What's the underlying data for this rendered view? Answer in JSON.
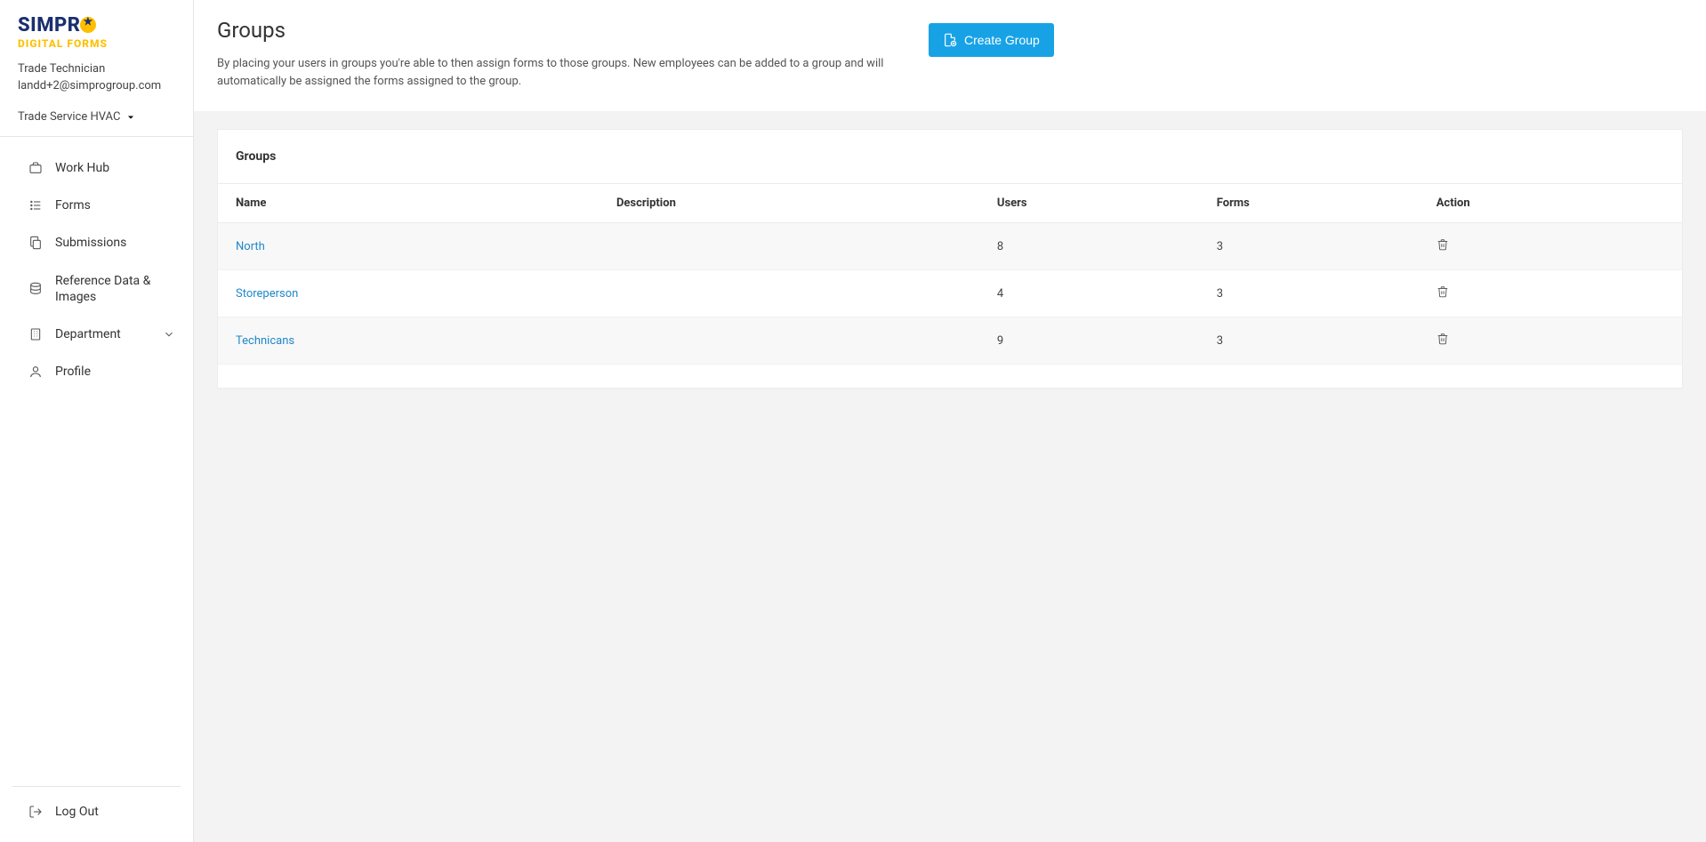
{
  "brand": {
    "line1": "SIMPR",
    "line2": "DIGITAL FORMS"
  },
  "user": {
    "role": "Trade Technician",
    "email": "landd+2@simprogroup.com",
    "org": "Trade Service HVAC"
  },
  "nav": {
    "items": [
      {
        "label": "Work Hub",
        "icon": "briefcase-icon",
        "expandable": false
      },
      {
        "label": "Forms",
        "icon": "list-icon",
        "expandable": false
      },
      {
        "label": "Submissions",
        "icon": "copy-icon",
        "expandable": false
      },
      {
        "label": "Reference Data & Images",
        "icon": "database-icon",
        "expandable": false
      },
      {
        "label": "Department",
        "icon": "building-icon",
        "expandable": true
      },
      {
        "label": "Profile",
        "icon": "user-icon",
        "expandable": false
      }
    ],
    "logout": "Log Out"
  },
  "page": {
    "title": "Groups",
    "subtitle": "By placing your users in groups you're able to then assign forms to those groups. New employees can be added to a group and will automatically be assigned the forms assigned to the group.",
    "create_label": "Create Group"
  },
  "panel": {
    "title": "Groups",
    "columns": {
      "name": "Name",
      "description": "Description",
      "users": "Users",
      "forms": "Forms",
      "action": "Action"
    },
    "rows": [
      {
        "name": "North",
        "description": "",
        "users": "8",
        "forms": "3"
      },
      {
        "name": "Storeperson",
        "description": "",
        "users": "4",
        "forms": "3"
      },
      {
        "name": "Technicans",
        "description": "",
        "users": "9",
        "forms": "3"
      }
    ]
  }
}
